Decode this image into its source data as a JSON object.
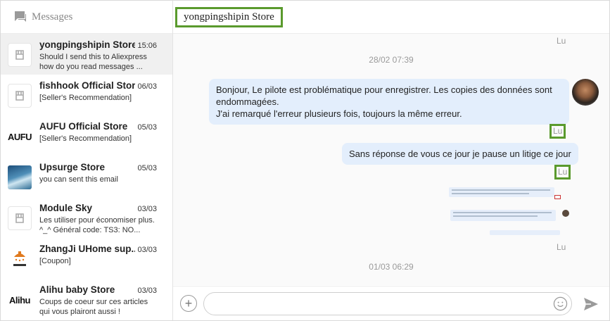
{
  "sidebar": {
    "title": "Messages",
    "conversations": [
      {
        "name": "yongpingshipin Store",
        "time": "15:06",
        "preview": "Should I send this to Aliexpress how do you read messages ...",
        "avatar": "shop-icon"
      },
      {
        "name": "fishhook Official Store",
        "time": "06/03",
        "preview": "[Seller's Recommendation]",
        "avatar": "shop-icon"
      },
      {
        "name": "AUFU Official Store",
        "time": "05/03",
        "preview": "[Seller's Recommendation]",
        "avatar": "AUFU"
      },
      {
        "name": "Upsurge Store",
        "time": "05/03",
        "preview": "you can sent this email",
        "avatar": "wave-image"
      },
      {
        "name": "Module Sky",
        "time": "03/03",
        "preview": "Les utiliser pour économiser plus. ^_^ Général code: TS3: NO...",
        "avatar": "shop-icon"
      },
      {
        "name": "ZhangJi UHome sup...",
        "time": "03/03",
        "preview": "[Coupon]",
        "avatar": "shower-logo"
      },
      {
        "name": "Alihu baby Store",
        "time": "03/03",
        "preview": "Coups de coeur sur ces articles qui vous plairont aussi !",
        "avatar": "Alihu"
      }
    ]
  },
  "chat": {
    "title": "yongpingshipin Store",
    "read_label": "Lu",
    "date1": "28/02 07:39",
    "msg1": "Bonjour, Le pilote est problématique pour enregistrer. Les copies des données sont endommagées.\nJ'ai remarqué l'erreur plusieurs fois, toujours la même erreur.",
    "msg2": "Sans réponse de vous ce jour je pause un litige ce jour",
    "date2": "01/03 06:29"
  },
  "composer": {
    "placeholder": ""
  },
  "colors": {
    "highlight": "#5a9a2d",
    "bubble": "#e3eefc"
  }
}
